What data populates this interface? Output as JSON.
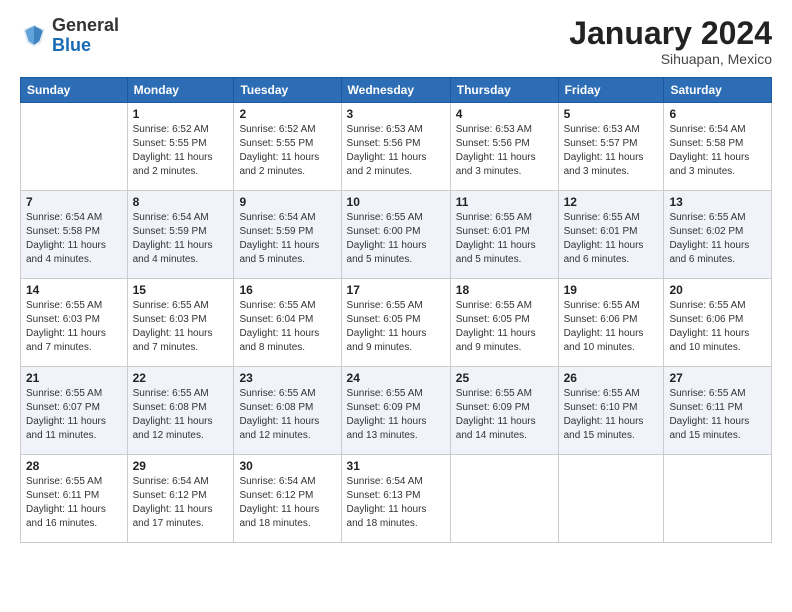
{
  "logo": {
    "general": "General",
    "blue": "Blue"
  },
  "title": "January 2024",
  "location": "Sihuapan, Mexico",
  "days_of_week": [
    "Sunday",
    "Monday",
    "Tuesday",
    "Wednesday",
    "Thursday",
    "Friday",
    "Saturday"
  ],
  "weeks": [
    [
      {
        "day": "",
        "sunrise": "",
        "sunset": "",
        "daylight": ""
      },
      {
        "day": "1",
        "sunrise": "Sunrise: 6:52 AM",
        "sunset": "Sunset: 5:55 PM",
        "daylight": "Daylight: 11 hours and 2 minutes."
      },
      {
        "day": "2",
        "sunrise": "Sunrise: 6:52 AM",
        "sunset": "Sunset: 5:55 PM",
        "daylight": "Daylight: 11 hours and 2 minutes."
      },
      {
        "day": "3",
        "sunrise": "Sunrise: 6:53 AM",
        "sunset": "Sunset: 5:56 PM",
        "daylight": "Daylight: 11 hours and 2 minutes."
      },
      {
        "day": "4",
        "sunrise": "Sunrise: 6:53 AM",
        "sunset": "Sunset: 5:56 PM",
        "daylight": "Daylight: 11 hours and 3 minutes."
      },
      {
        "day": "5",
        "sunrise": "Sunrise: 6:53 AM",
        "sunset": "Sunset: 5:57 PM",
        "daylight": "Daylight: 11 hours and 3 minutes."
      },
      {
        "day": "6",
        "sunrise": "Sunrise: 6:54 AM",
        "sunset": "Sunset: 5:58 PM",
        "daylight": "Daylight: 11 hours and 3 minutes."
      }
    ],
    [
      {
        "day": "7",
        "sunrise": "Sunrise: 6:54 AM",
        "sunset": "Sunset: 5:58 PM",
        "daylight": "Daylight: 11 hours and 4 minutes."
      },
      {
        "day": "8",
        "sunrise": "Sunrise: 6:54 AM",
        "sunset": "Sunset: 5:59 PM",
        "daylight": "Daylight: 11 hours and 4 minutes."
      },
      {
        "day": "9",
        "sunrise": "Sunrise: 6:54 AM",
        "sunset": "Sunset: 5:59 PM",
        "daylight": "Daylight: 11 hours and 5 minutes."
      },
      {
        "day": "10",
        "sunrise": "Sunrise: 6:55 AM",
        "sunset": "Sunset: 6:00 PM",
        "daylight": "Daylight: 11 hours and 5 minutes."
      },
      {
        "day": "11",
        "sunrise": "Sunrise: 6:55 AM",
        "sunset": "Sunset: 6:01 PM",
        "daylight": "Daylight: 11 hours and 5 minutes."
      },
      {
        "day": "12",
        "sunrise": "Sunrise: 6:55 AM",
        "sunset": "Sunset: 6:01 PM",
        "daylight": "Daylight: 11 hours and 6 minutes."
      },
      {
        "day": "13",
        "sunrise": "Sunrise: 6:55 AM",
        "sunset": "Sunset: 6:02 PM",
        "daylight": "Daylight: 11 hours and 6 minutes."
      }
    ],
    [
      {
        "day": "14",
        "sunrise": "Sunrise: 6:55 AM",
        "sunset": "Sunset: 6:03 PM",
        "daylight": "Daylight: 11 hours and 7 minutes."
      },
      {
        "day": "15",
        "sunrise": "Sunrise: 6:55 AM",
        "sunset": "Sunset: 6:03 PM",
        "daylight": "Daylight: 11 hours and 7 minutes."
      },
      {
        "day": "16",
        "sunrise": "Sunrise: 6:55 AM",
        "sunset": "Sunset: 6:04 PM",
        "daylight": "Daylight: 11 hours and 8 minutes."
      },
      {
        "day": "17",
        "sunrise": "Sunrise: 6:55 AM",
        "sunset": "Sunset: 6:05 PM",
        "daylight": "Daylight: 11 hours and 9 minutes."
      },
      {
        "day": "18",
        "sunrise": "Sunrise: 6:55 AM",
        "sunset": "Sunset: 6:05 PM",
        "daylight": "Daylight: 11 hours and 9 minutes."
      },
      {
        "day": "19",
        "sunrise": "Sunrise: 6:55 AM",
        "sunset": "Sunset: 6:06 PM",
        "daylight": "Daylight: 11 hours and 10 minutes."
      },
      {
        "day": "20",
        "sunrise": "Sunrise: 6:55 AM",
        "sunset": "Sunset: 6:06 PM",
        "daylight": "Daylight: 11 hours and 10 minutes."
      }
    ],
    [
      {
        "day": "21",
        "sunrise": "Sunrise: 6:55 AM",
        "sunset": "Sunset: 6:07 PM",
        "daylight": "Daylight: 11 hours and 11 minutes."
      },
      {
        "day": "22",
        "sunrise": "Sunrise: 6:55 AM",
        "sunset": "Sunset: 6:08 PM",
        "daylight": "Daylight: 11 hours and 12 minutes."
      },
      {
        "day": "23",
        "sunrise": "Sunrise: 6:55 AM",
        "sunset": "Sunset: 6:08 PM",
        "daylight": "Daylight: 11 hours and 12 minutes."
      },
      {
        "day": "24",
        "sunrise": "Sunrise: 6:55 AM",
        "sunset": "Sunset: 6:09 PM",
        "daylight": "Daylight: 11 hours and 13 minutes."
      },
      {
        "day": "25",
        "sunrise": "Sunrise: 6:55 AM",
        "sunset": "Sunset: 6:09 PM",
        "daylight": "Daylight: 11 hours and 14 minutes."
      },
      {
        "day": "26",
        "sunrise": "Sunrise: 6:55 AM",
        "sunset": "Sunset: 6:10 PM",
        "daylight": "Daylight: 11 hours and 15 minutes."
      },
      {
        "day": "27",
        "sunrise": "Sunrise: 6:55 AM",
        "sunset": "Sunset: 6:11 PM",
        "daylight": "Daylight: 11 hours and 15 minutes."
      }
    ],
    [
      {
        "day": "28",
        "sunrise": "Sunrise: 6:55 AM",
        "sunset": "Sunset: 6:11 PM",
        "daylight": "Daylight: 11 hours and 16 minutes."
      },
      {
        "day": "29",
        "sunrise": "Sunrise: 6:54 AM",
        "sunset": "Sunset: 6:12 PM",
        "daylight": "Daylight: 11 hours and 17 minutes."
      },
      {
        "day": "30",
        "sunrise": "Sunrise: 6:54 AM",
        "sunset": "Sunset: 6:12 PM",
        "daylight": "Daylight: 11 hours and 18 minutes."
      },
      {
        "day": "31",
        "sunrise": "Sunrise: 6:54 AM",
        "sunset": "Sunset: 6:13 PM",
        "daylight": "Daylight: 11 hours and 18 minutes."
      },
      {
        "day": "",
        "sunrise": "",
        "sunset": "",
        "daylight": ""
      },
      {
        "day": "",
        "sunrise": "",
        "sunset": "",
        "daylight": ""
      },
      {
        "day": "",
        "sunrise": "",
        "sunset": "",
        "daylight": ""
      }
    ]
  ]
}
